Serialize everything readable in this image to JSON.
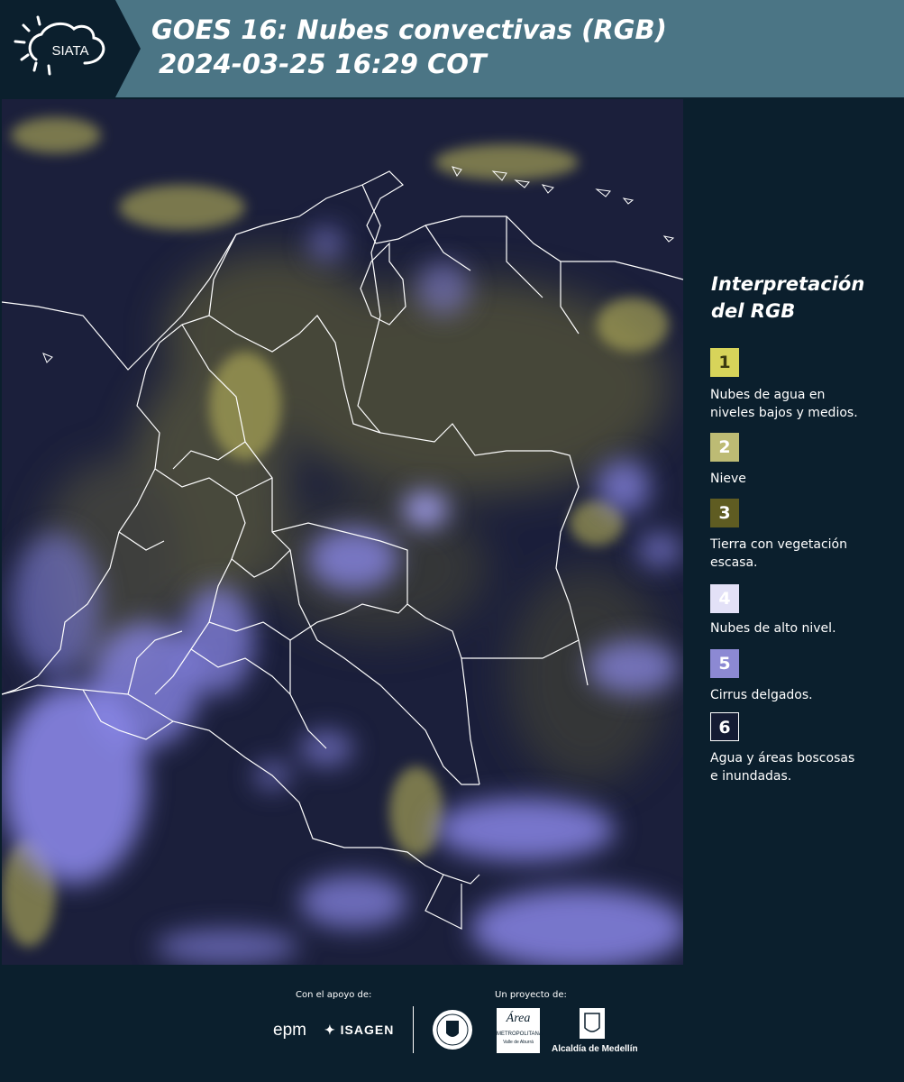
{
  "header": {
    "logo_text": "SIATA",
    "title_line1": "GOES 16: Nubes convectivas (RGB)",
    "title_line2": "2024-03-25 16:29 COT"
  },
  "legend": {
    "title_line1": "Interpretación",
    "title_line2": "del RGB",
    "items": [
      {
        "number": "1",
        "label_lines": [
          "Nubes de agua en",
          "niveles bajos y medios."
        ],
        "color": "#d7d45a",
        "text_color": "#3a3a10"
      },
      {
        "number": "2",
        "label_lines": [
          "Nieve"
        ],
        "color": "#bdbb74",
        "text_color": "#ffffff"
      },
      {
        "number": "3",
        "label_lines": [
          "Tierra con vegetación",
          "escasa."
        ],
        "color": "#5f5c22",
        "text_color": "#ffffff"
      },
      {
        "number": "4",
        "label_lines": [
          "Nubes de alto nivel."
        ],
        "color": "#e3e1f7",
        "text_color": "#ffffff"
      },
      {
        "number": "5",
        "label_lines": [
          "Cirrus delgados."
        ],
        "color": "#8c89d3",
        "text_color": "#ffffff"
      },
      {
        "number": "6",
        "label_lines": [
          "Agua y áreas boscosas",
          "e inundadas."
        ],
        "color": "#141b33",
        "text_color": "#ffffff",
        "border": "#ffffff"
      }
    ]
  },
  "footer": {
    "support_label": "Con el apoyo de:",
    "project_label": "Un proyecto de:",
    "sponsor_epm": "epm",
    "sponsor_isagen": "ISAGEN",
    "partner_metropolitana_line1": "Área",
    "partner_metropolitana_line2": "METROPOLITANA",
    "partner_metropolitana_line3": "Valle de Aburrá",
    "partner_alcaldia": "Alcaldía de Medellín"
  },
  "colors": {
    "header_bg": "#4b7585",
    "panel_bg": "#0b1f2d",
    "map_bg": "#1b1f3b",
    "convective_cloud": "#8f8cf0",
    "low_cloud": "#b9b45a",
    "border_lines": "#ffffff"
  }
}
